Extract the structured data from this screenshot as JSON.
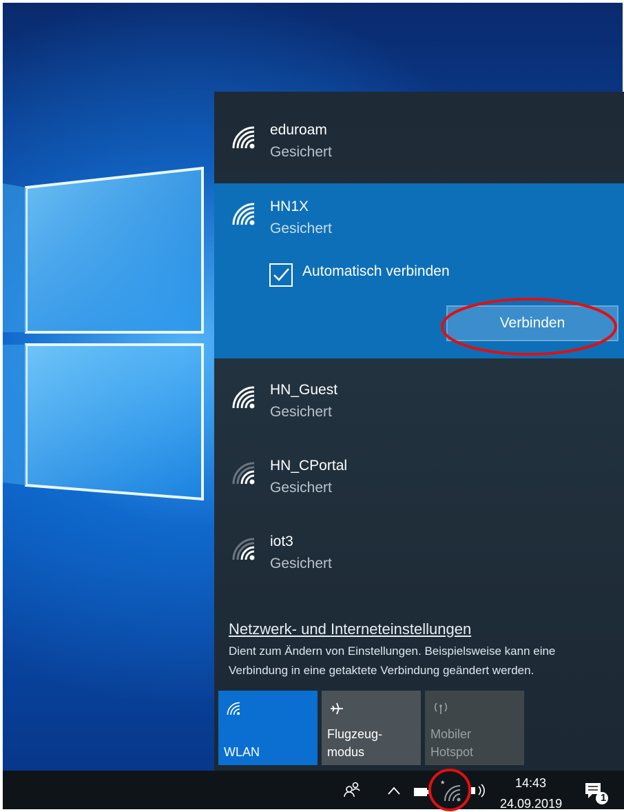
{
  "networks": [
    {
      "name": "eduroam",
      "status": "Gesichert"
    },
    {
      "name": "HN1X",
      "status": "Gesichert",
      "auto_connect_label": "Automatisch verbinden",
      "connect_label": "Verbinden"
    },
    {
      "name": "HN_Guest",
      "status": "Gesichert"
    },
    {
      "name": "HN_CPortal",
      "status": "Gesichert"
    },
    {
      "name": "iot3",
      "status": "Gesichert"
    }
  ],
  "settings": {
    "link": "Netzwerk- und Interneteinstellungen",
    "description": "Dient zum Ändern von Einstellungen. Beispielsweise kann eine Verbindung in eine getaktete Verbindung geändert werden."
  },
  "tiles": [
    {
      "label_line1": "WLAN",
      "label_line2": "",
      "icon": "wifi-icon",
      "state": "on"
    },
    {
      "label_line1": "Flugzeug-",
      "label_line2": "modus",
      "icon": "airplane-icon",
      "state": "off"
    },
    {
      "label_line1": "Mobiler",
      "label_line2": "Hotspot",
      "icon": "hotspot-icon",
      "state": "disabled"
    }
  ],
  "taskbar": {
    "time": "14:43",
    "date": "24.09.2019",
    "notification_count": "1"
  },
  "colors": {
    "accent": "#0d6fb8",
    "tile_active": "#0a6fd1",
    "highlight": "#e01010"
  }
}
